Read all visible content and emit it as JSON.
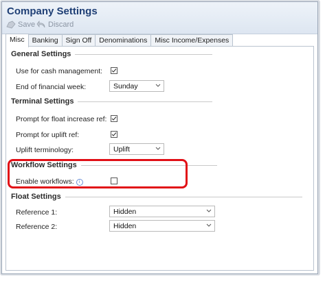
{
  "window": {
    "title": "Company Settings"
  },
  "toolbar": {
    "save_label": "Save",
    "discard_label": "Discard"
  },
  "tabs": [
    {
      "label": "Misc",
      "active": true
    },
    {
      "label": "Banking",
      "active": false
    },
    {
      "label": "Sign Off",
      "active": false
    },
    {
      "label": "Denominations",
      "active": false
    },
    {
      "label": "Misc Income/Expenses",
      "active": false
    }
  ],
  "general": {
    "heading": "General Settings",
    "cash_management_label": "Use for cash management:",
    "cash_management_checked": true,
    "end_week_label": "End of financial week:",
    "end_week_value": "Sunday"
  },
  "terminal": {
    "heading": "Terminal Settings",
    "float_ref_label": "Prompt for float increase ref:",
    "float_ref_checked": true,
    "uplift_ref_label": "Prompt for uplift ref:",
    "uplift_ref_checked": true,
    "uplift_term_label": "Uplift terminology:",
    "uplift_term_value": "Uplift"
  },
  "workflow": {
    "heading": "Workflow Settings",
    "enable_label": "Enable workflows:",
    "enable_checked": false
  },
  "float": {
    "heading": "Float Settings",
    "ref1_label": "Reference 1:",
    "ref1_value": "Hidden",
    "ref2_label": "Reference 2:",
    "ref2_value": "Hidden"
  },
  "colors": {
    "title": "#1f3f75",
    "highlight": "#e10f16"
  }
}
